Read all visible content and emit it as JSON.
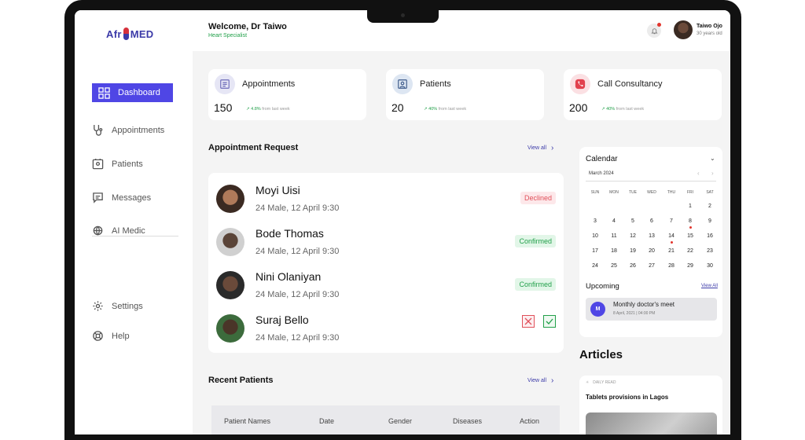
{
  "app": {
    "logo_left": "Afr",
    "logo_right": "MED"
  },
  "header": {
    "welcome": "Welcome, Dr Taiwo",
    "role": "Heart Specialist",
    "user_name": "Taiwo Ojo",
    "user_age": "30 years old"
  },
  "sidebar": {
    "items": [
      {
        "label": "Dashboard"
      },
      {
        "label": "Appointments"
      },
      {
        "label": "Patients"
      },
      {
        "label": "Messages"
      },
      {
        "label": "AI Medic"
      },
      {
        "label": "Settings"
      },
      {
        "label": "Help"
      }
    ]
  },
  "stats": [
    {
      "title": "Appointments",
      "value": "150",
      "trend": "4.8%",
      "trend_suffix": "from last week"
    },
    {
      "title": "Patients",
      "value": "20",
      "trend": "40%",
      "trend_suffix": "from last week"
    },
    {
      "title": "Call Consultancy",
      "value": "200",
      "trend": "40%",
      "trend_suffix": "from last week"
    }
  ],
  "appointment_request": {
    "title": "Appointment Request",
    "view_all": "View all",
    "rows": [
      {
        "name": "Moyi Uisi",
        "meta": "24 Male, 12 April 9:30",
        "status": "Declined"
      },
      {
        "name": "Bode Thomas",
        "meta": "24 Male, 12 April 9:30",
        "status": "Confirmed"
      },
      {
        "name": "Nini Olaniyan",
        "meta": "24 Male, 12 April 9:30",
        "status": "Confirmed"
      },
      {
        "name": "Suraj Bello",
        "meta": "24 Male, 12 April 9:30",
        "status": ""
      }
    ]
  },
  "recent_patients": {
    "title": "Recent Patients",
    "view_all": "View all",
    "columns": [
      "Patient Names",
      "Date",
      "Gender",
      "Diseases",
      "Action"
    ]
  },
  "calendar": {
    "title": "Calendar",
    "month": "March 2024",
    "weekdays": [
      "SUN",
      "MON",
      "TUE",
      "WED",
      "THU",
      "FRI",
      "SAT"
    ],
    "weeks": [
      [
        "",
        "",
        "",
        "",
        "",
        "1",
        "2"
      ],
      [
        "3",
        "4",
        "5",
        "6",
        "7",
        "8",
        "9"
      ],
      [
        "10",
        "11",
        "12",
        "13",
        "14",
        "15",
        "16"
      ],
      [
        "17",
        "18",
        "19",
        "20",
        "21",
        "22",
        "23"
      ],
      [
        "24",
        "25",
        "26",
        "27",
        "28",
        "29",
        "30"
      ]
    ],
    "marked_days": [
      "8",
      "14"
    ]
  },
  "upcoming": {
    "title": "Upcoming",
    "view_all": "View All",
    "event": {
      "initial": "M",
      "title": "Monthly doctor's meet",
      "date": "8 April, 2021",
      "time": "04:00 PM"
    }
  },
  "articles": {
    "title": "Articles",
    "tag": "DAILY READ",
    "headline": "Tablets provisions in Lagos"
  },
  "colors": {
    "accent": "#4f46e5",
    "success": "#22a04a",
    "danger": "#e0505a"
  }
}
